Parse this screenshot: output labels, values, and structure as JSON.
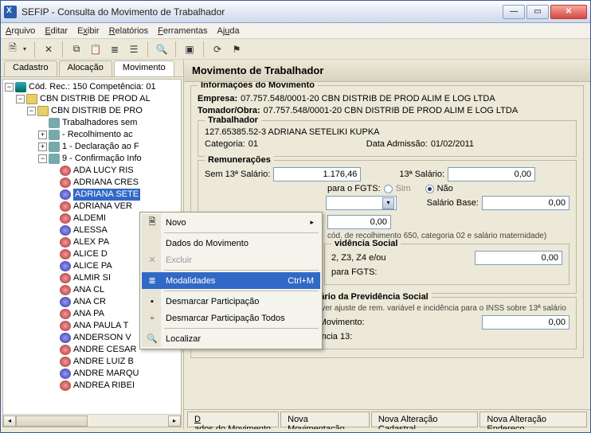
{
  "window": {
    "title": "SEFIP - Consulta do Movimento de Trabalhador"
  },
  "menubar": {
    "arquivo": "Arquivo",
    "editar": "Editar",
    "exibir": "Exibir",
    "relatorios": "Relatórios",
    "ferramentas": "Ferramentas",
    "ajuda": "Ajuda"
  },
  "left_tabs": {
    "cadastro": "Cadastro",
    "alocacao": "Alocação",
    "movimento": "Movimento"
  },
  "tree": {
    "root": "Cód. Rec.: 150 Competência: 01",
    "empresa": "CBN DISTRIB DE PROD AL",
    "tomador": "CBN DISTRIB DE PRO",
    "branch_trab": "Trabalhadores sem",
    "branch_rec": "- Recolhimento ac",
    "branch_decl": "1 - Declaração ao F",
    "branch_conf": "9 - Confirmação Info",
    "workers": [
      "ADA LUCY RIS",
      "ADRIANA CRES",
      "ADRIANA SETE",
      "ADRIANA VER",
      "ALDEMI",
      "ALESSA",
      "ALEX PA",
      "ALICE D",
      "ALICE PA",
      "ALMIR SI",
      "ANA CL",
      "ANA CR",
      "ANA PA",
      "ANA PAULA T",
      "ANDERSON V",
      "ANDRE CESAR",
      "ANDRE LUIZ B",
      "ANDRE MARQU",
      "ANDREA RIBEI"
    ],
    "selected_index": 2
  },
  "context_menu": {
    "novo": "Novo",
    "dados": "Dados do Movimento",
    "excluir": "Excluir",
    "modalidades": "Modalidades",
    "modalidades_accel": "Ctrl+M",
    "desmarcar": "Desmarcar Participação",
    "desmarcar_todos": "Desmarcar Participação Todos",
    "localizar": "Localizar"
  },
  "right": {
    "header": "Movimento de Trabalhador",
    "grp_info": "Informações do Movimento",
    "empresa_label": "Empresa:",
    "empresa_value": "07.757.548/0001-20 CBN DISTRIB DE PROD ALIM E LOG LTDA",
    "tomador_label": "Tomador/Obra:",
    "tomador_value": "07.757.548/0001-20 CBN DISTRIB DE PROD ALIM E LOG LTDA",
    "grp_trab": "Trabalhador",
    "trab_id": "127.65385.52-3 ADRIANA SETELIKI KUPKA",
    "categoria_label": "Categoria:",
    "categoria_value": "01",
    "data_admissao_label": "Data Admissão:",
    "data_admissao_value": "01/02/2011",
    "grp_rem": "Remunerações",
    "sem13_label": "Sem 13ª Salário:",
    "sem13_value": "1.176,46",
    "sal13_label": "13ª Salário:",
    "sal13_value": "0,00",
    "fgts_frag": "para o FGTS:",
    "sim": "Sim",
    "nao": "Não",
    "salbase_label": "Salário Base:",
    "salbase_value": "0,00",
    "zero": "0,00",
    "note_cat": "cód. de recolhimento 650, categoria 02 e salário maternidade)",
    "grp_prev": "vidência Social",
    "prev_s2": "2, Z3, Z4 e/ou",
    "prev_fgts": "para FGTS:",
    "prev_value": "0,00",
    "grp_base13": "Base de Cálculo do 13ª Salário da Previdência Social",
    "base13_note": "(Preencher somente quando houver ajuste de rem. variável e incidência para o INSS sobre 13ª salário",
    "ref_comp_label": "Referente à Competência do Movimento:",
    "ref_comp_value": "0,00",
    "ref_gps_label": "Referente à GPS da Competência 13:"
  },
  "bottom_tabs": {
    "dados": "Dados do Movimento",
    "nova_mov": "Nova Movimentação",
    "nova_alt_cad": "Nova Alteração Cadastral",
    "nova_alt_end": "Nova Alteração Endereço"
  }
}
